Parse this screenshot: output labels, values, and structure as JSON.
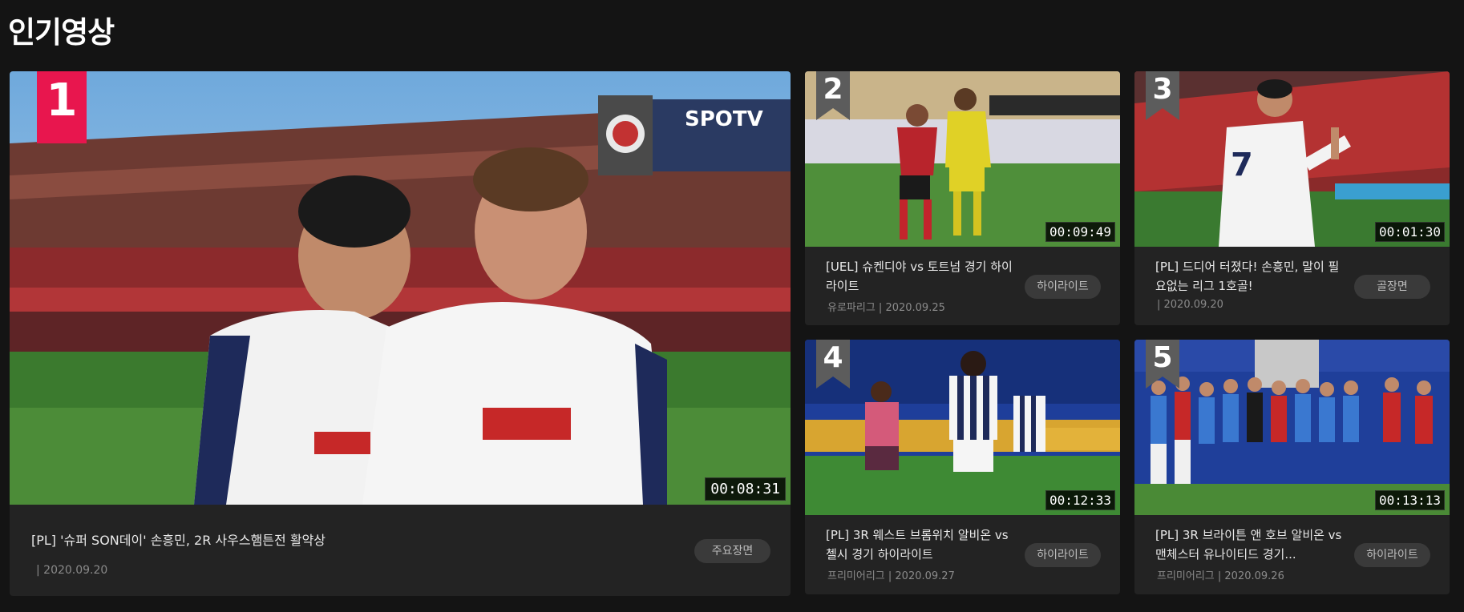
{
  "section": {
    "title": "인기영상"
  },
  "colors": {
    "background": "#141414",
    "card": "#232323",
    "rank_first": "#e8164e",
    "rank_other": "#5c5c5c"
  },
  "videos": [
    {
      "rank": "1",
      "duration": "00:08:31",
      "title": "[PL] '슈퍼 SON데이' 손흥민, 2R 사우스햄튼전 활약상",
      "meta": "|  2020.09.20",
      "tag": "주요장면",
      "thumbnail_icon": "players-celebrating-thumbnail"
    },
    {
      "rank": "2",
      "duration": "00:09:49",
      "title": "[UEL] 슈켄디야 vs 토트넘 경기 하이라이트",
      "meta": "유로파리그  |  2020.09.25",
      "tag": "하이라이트",
      "thumbnail_icon": "match-action-thumbnail"
    },
    {
      "rank": "3",
      "duration": "00:01:30",
      "title": "[PL] 드디어 터졌다! 손흥민, 말이 필요없는 리그 1호골!",
      "meta": "|  2020.09.20",
      "tag": "골장면",
      "thumbnail_icon": "player-gesture-thumbnail"
    },
    {
      "rank": "4",
      "duration": "00:12:33",
      "title": "[PL] 3R 웨스트 브롬위치 알비온 vs 첼시 경기 하이라이트",
      "meta": "프리미어리그  |  2020.09.27",
      "tag": "하이라이트",
      "thumbnail_icon": "players-kneeling-thumbnail"
    },
    {
      "rank": "5",
      "duration": "00:13:13",
      "title": "[PL] 3R 브라이튼 앤 호브 알비온 vs 맨체스터 유나이티드 경기...",
      "meta": "프리미어리그  |  2020.09.26",
      "tag": "하이라이트",
      "thumbnail_icon": "team-lineup-thumbnail"
    }
  ],
  "thumbnail_overlays": {
    "broadcaster": "SPOTV"
  }
}
